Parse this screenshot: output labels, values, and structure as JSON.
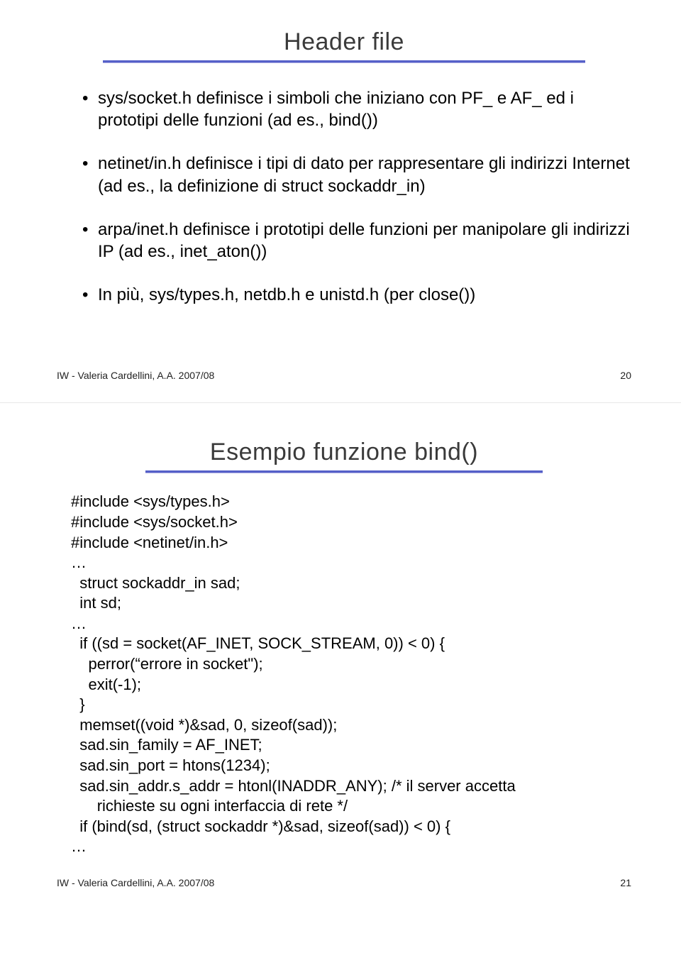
{
  "slide1": {
    "title": "Header file",
    "bullets": [
      "sys/socket.h definisce i simboli che iniziano con PF_ e AF_ ed i prototipi delle funzioni (ad es., bind())",
      "netinet/in.h definisce i tipi di dato per rappresentare gli indirizzi Internet (ad es., la definizione di struct sockaddr_in)",
      "arpa/inet.h definisce i prototipi delle funzioni per manipolare gli indirizzi IP (ad es., inet_aton())",
      "In più, sys/types.h, netdb.h e unistd.h (per close())"
    ],
    "footer_left": "IW - Valeria Cardellini, A.A. 2007/08",
    "footer_right": "20"
  },
  "slide2": {
    "title": "Esempio funzione bind()",
    "code": "#include <sys/types.h>\n#include <sys/socket.h>\n#include <netinet/in.h>\n…\n  struct sockaddr_in sad;\n  int sd;\n…\n  if ((sd = socket(AF_INET, SOCK_STREAM, 0)) < 0) {\n    perror(“errore in socket\");\n    exit(-1);\n  }\n  memset((void *)&sad, 0, sizeof(sad));\n  sad.sin_family = AF_INET;\n  sad.sin_port = htons(1234);\n  sad.sin_addr.s_addr = htonl(INADDR_ANY); /* il server accetta\n      richieste su ogni interfaccia di rete */\n  if (bind(sd, (struct sockaddr *)&sad, sizeof(sad)) < 0) {\n…",
    "footer_left": "IW - Valeria Cardellini, A.A. 2007/08",
    "footer_right": "21"
  }
}
